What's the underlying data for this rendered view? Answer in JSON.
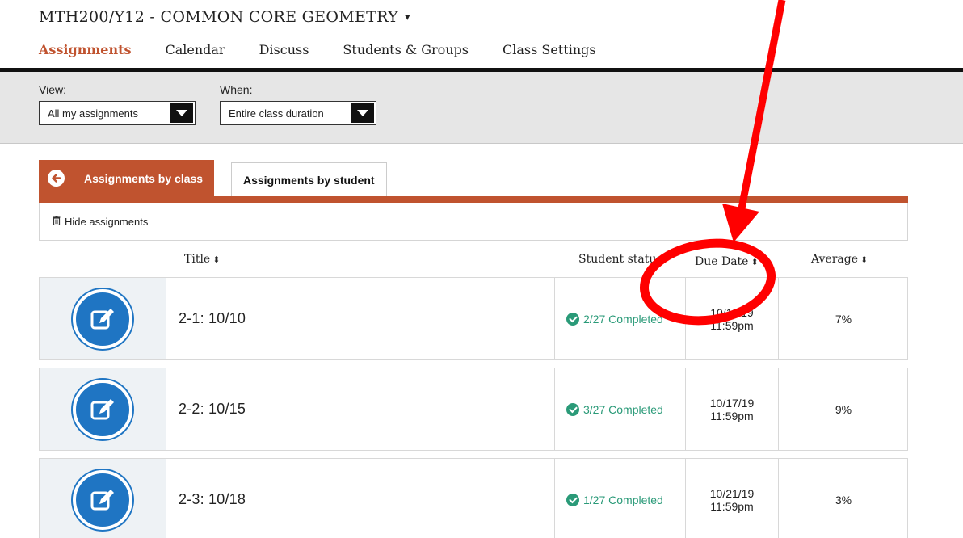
{
  "course": {
    "title": "MTH200/Y12 - COMMON CORE GEOMETRY",
    "caret": "▾"
  },
  "nav": {
    "tabs": [
      "Assignments",
      "Calendar",
      "Discuss",
      "Students & Groups",
      "Class Settings"
    ],
    "active": 0
  },
  "filters": {
    "view": {
      "label": "View:",
      "value": "All my assignments"
    },
    "when": {
      "label": "When:",
      "value": "Entire class duration"
    }
  },
  "subtabs": {
    "by_class": "Assignments by class",
    "by_student": "Assignments by student"
  },
  "hide_label": "Hide assignments",
  "columns": {
    "title": "Title",
    "status": "Student status",
    "due": "Due Date",
    "average": "Average"
  },
  "rows": [
    {
      "title": "2-1: 10/10",
      "status": "2/27 Completed",
      "due_date": "10/11/19",
      "due_time": "11:59pm",
      "average": "7%"
    },
    {
      "title": "2-2: 10/15",
      "status": "3/27 Completed",
      "due_date": "10/17/19",
      "due_time": "11:59pm",
      "average": "9%"
    },
    {
      "title": "2-3: 10/18",
      "status": "1/27 Completed",
      "due_date": "10/21/19",
      "due_time": "11:59pm",
      "average": "3%"
    }
  ],
  "colors": {
    "accent": "#c0532f",
    "status_green": "#2a9a78",
    "icon_blue": "#1f75c3",
    "annotation_red": "#ff0000"
  }
}
